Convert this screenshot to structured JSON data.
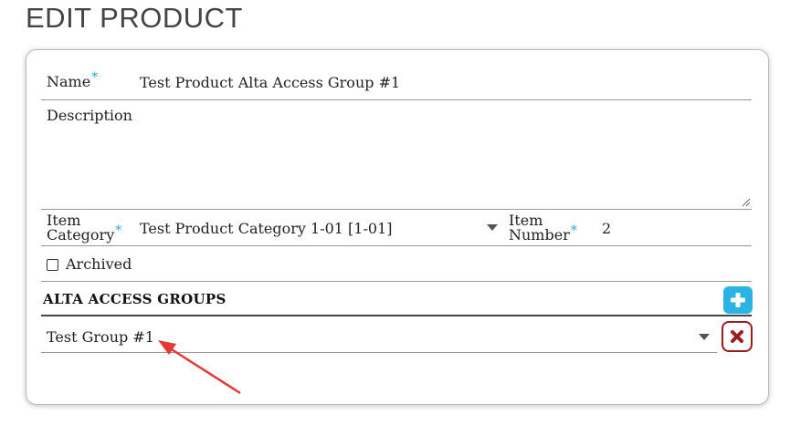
{
  "page": {
    "title": "EDIT PRODUCT"
  },
  "form": {
    "name_label": "Name",
    "required_marker": "*",
    "name_value": "Test Product Alta Access Group #1",
    "description_label": "Description",
    "description_value": "",
    "item_category_label_line1": "Item",
    "item_category_label_line2": "Category",
    "item_category_value": "Test Product Category 1-01 [1-01]",
    "item_number_label_line1": "Item",
    "item_number_label_line2": "Number",
    "item_number_value": "2",
    "archived_label": "Archived",
    "archived_checked": false
  },
  "access_groups": {
    "section_title": "ALTA ACCESS GROUPS",
    "add_icon": "plus-icon",
    "remove_icon": "x-icon",
    "rows": [
      {
        "value": "Test Group #1"
      }
    ]
  },
  "colors": {
    "required": "#29a9e0",
    "add_button": "#2bb3e3",
    "remove_button": "#9c1c1c",
    "annotation_arrow": "#e53935"
  }
}
